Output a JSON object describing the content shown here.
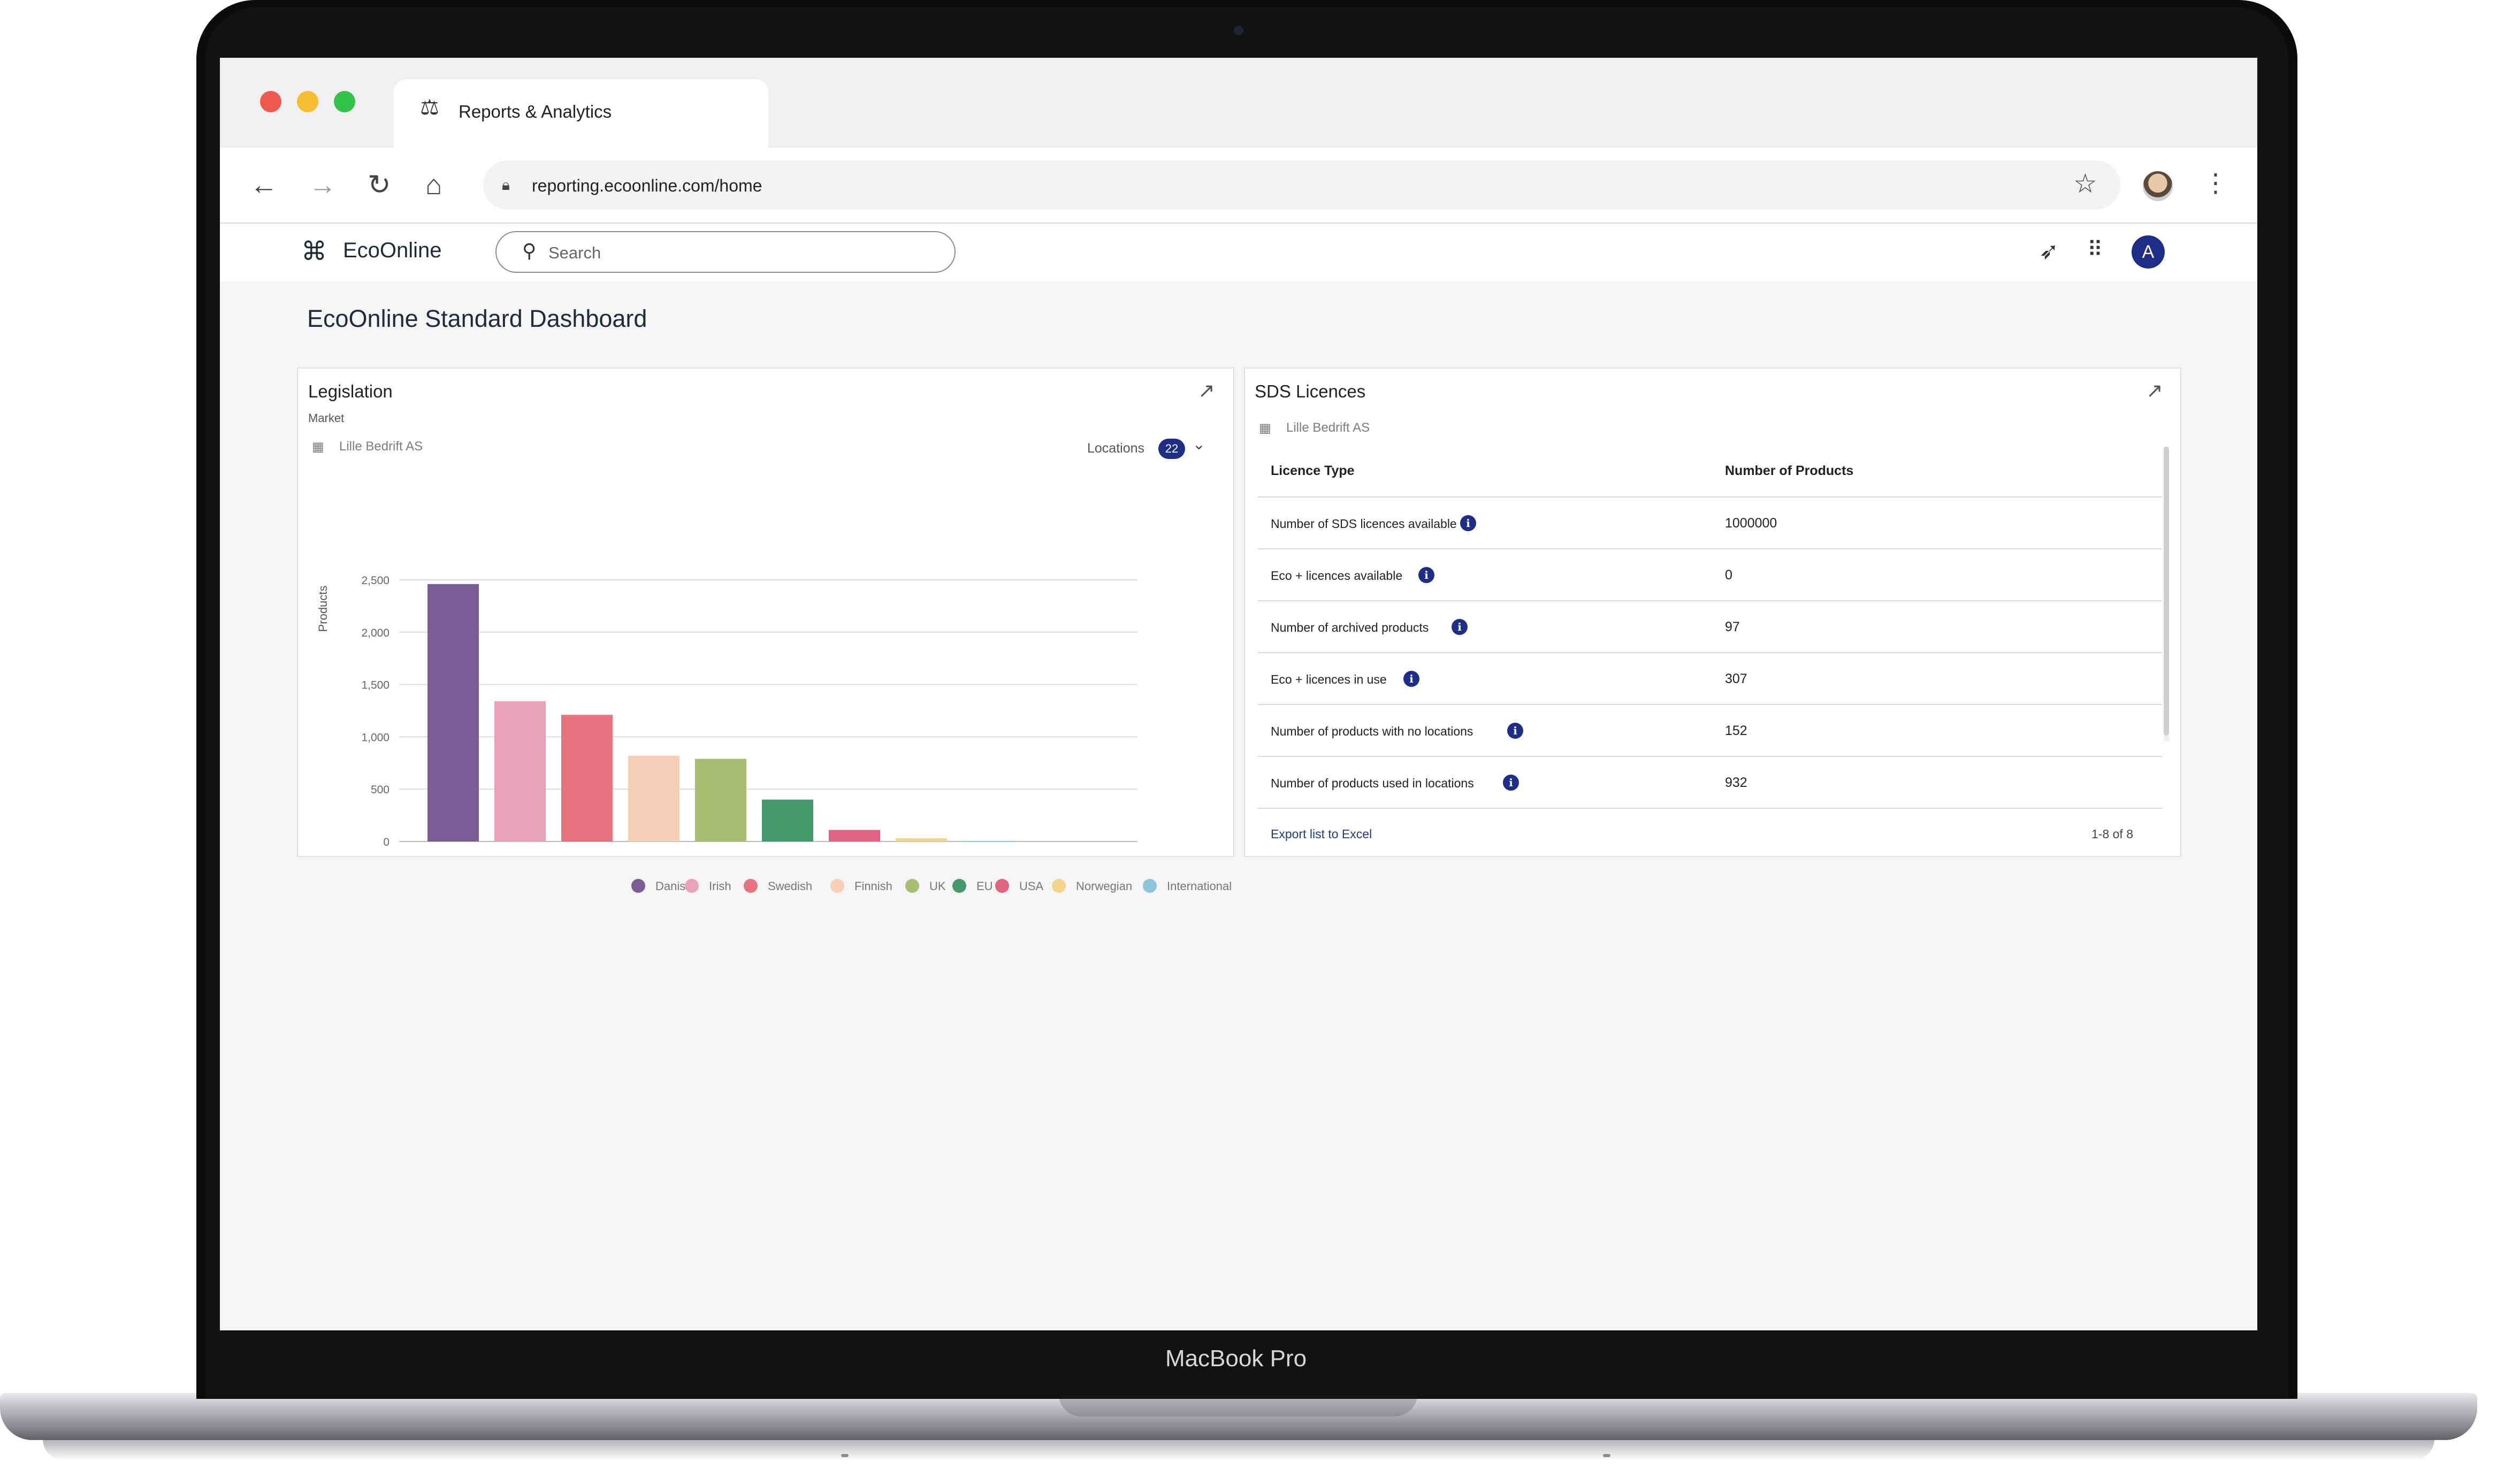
{
  "browser": {
    "tab_title": "Reports & Analytics",
    "url": "reporting.ecoonline.com/home"
  },
  "app": {
    "brand": "EcoOnline",
    "search_placeholder": "Search",
    "user_initial": "A"
  },
  "dashboard": {
    "title": "EcoOnline Standard Dashboard"
  },
  "legislation_card": {
    "title": "Legislation",
    "subtitle": "Market",
    "company": "Lille Bedrift AS",
    "locations_label": "Locations",
    "locations_count": "22"
  },
  "chart_data": {
    "type": "bar",
    "title": "Legislation",
    "ylabel": "Products",
    "xlabel": "",
    "ylim": [
      0,
      2500
    ],
    "yticks": [
      "2,500",
      "2,000",
      "1,500",
      "1,000",
      "500",
      "0"
    ],
    "categories": [
      "Danish",
      "Irish",
      "Swedish",
      "Finnish",
      "UK",
      "EU",
      "USA",
      "Norwegian",
      "International lists"
    ],
    "values": [
      2460,
      1340,
      1210,
      820,
      790,
      400,
      110,
      30,
      5
    ],
    "colors": [
      "#7a5c94",
      "#e8a2b8",
      "#e8737e",
      "#f7cfb6",
      "#a8bd72",
      "#429a6e",
      "#e06482",
      "#f1d58a",
      "#8fc4de"
    ],
    "legend": "bottom",
    "grid": true
  },
  "licences_card": {
    "title": "SDS Licences",
    "company": "Lille Bedrift AS",
    "columns": [
      "Licence Type",
      "Number of Products"
    ],
    "rows": [
      {
        "label": "Number of SDS licences available",
        "value": "1000000"
      },
      {
        "label": "Eco + licences available",
        "value": "0"
      },
      {
        "label": "Number of archived products",
        "value": "97"
      },
      {
        "label": "Eco + licences in use",
        "value": "307"
      },
      {
        "label": "Number of products with no locations",
        "value": "152"
      },
      {
        "label": "Number of products used in locations",
        "value": "932"
      }
    ],
    "export_label": "Export list to Excel",
    "pagination": "1-8 of 8"
  },
  "device": {
    "label": "MacBook Pro"
  },
  "colors": {
    "brand_navy": "#1e2d86",
    "title_text": "#1f2a3f"
  }
}
